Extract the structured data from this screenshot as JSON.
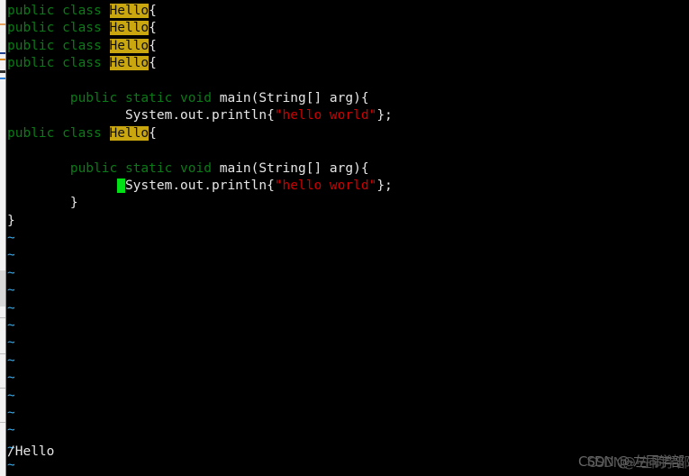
{
  "terminal": {
    "app": "vim",
    "colors": {
      "background": "#000000",
      "keyword_green": "#0b7a18",
      "plain_text": "#e6e6e6",
      "string_red": "#cc0000",
      "search_match_bg": "#cba70f",
      "search_match_fg": "#111111",
      "cursor_green": "#00e015",
      "tilde_blue": "#3aa8e8",
      "watermark_gray": "#6e6e6e"
    },
    "lines": [
      {
        "indent": "",
        "kw1": "public class ",
        "match": "Hello",
        "tail": "{"
      },
      {
        "indent": "",
        "kw1": "public class ",
        "match": "Hello",
        "tail": "{"
      },
      {
        "indent": "",
        "kw1": "public class ",
        "match": "Hello",
        "tail": "{"
      },
      {
        "indent": "",
        "kw1": "public class ",
        "match": "Hello",
        "tail": "{"
      }
    ],
    "code_block_one": {
      "line_blank": "",
      "line_main": {
        "indent": "        ",
        "kw": "public static void ",
        "sig": "main(String[] arg){"
      },
      "line_print": {
        "indent": "               ",
        "call": "System.out.println{",
        "string": "\"hello world\"",
        "tail": "};"
      },
      "line_class": {
        "kw": "public class ",
        "match": "Hello",
        "tail": "{"
      }
    },
    "code_block_two": {
      "line_blank": "",
      "line_main": {
        "indent": "        ",
        "kw": "public static void ",
        "sig": "main(String[] arg){"
      },
      "line_print": {
        "indent": "              ",
        "cursor": " ",
        "call": "System.out.println{",
        "string": "\"hello world\"",
        "tail": "};"
      },
      "line_close_inner": {
        "indent": "        ",
        "brace": "}"
      },
      "line_close_outer": {
        "brace": "}"
      }
    },
    "empty_line_marker": "~",
    "empty_line_count": 14,
    "status_line": {
      "command": "/Hello"
    }
  },
  "watermark": {
    "text_front": "CSDN @-左同学部",
    "text_back": "CSDN@-左同学部"
  }
}
